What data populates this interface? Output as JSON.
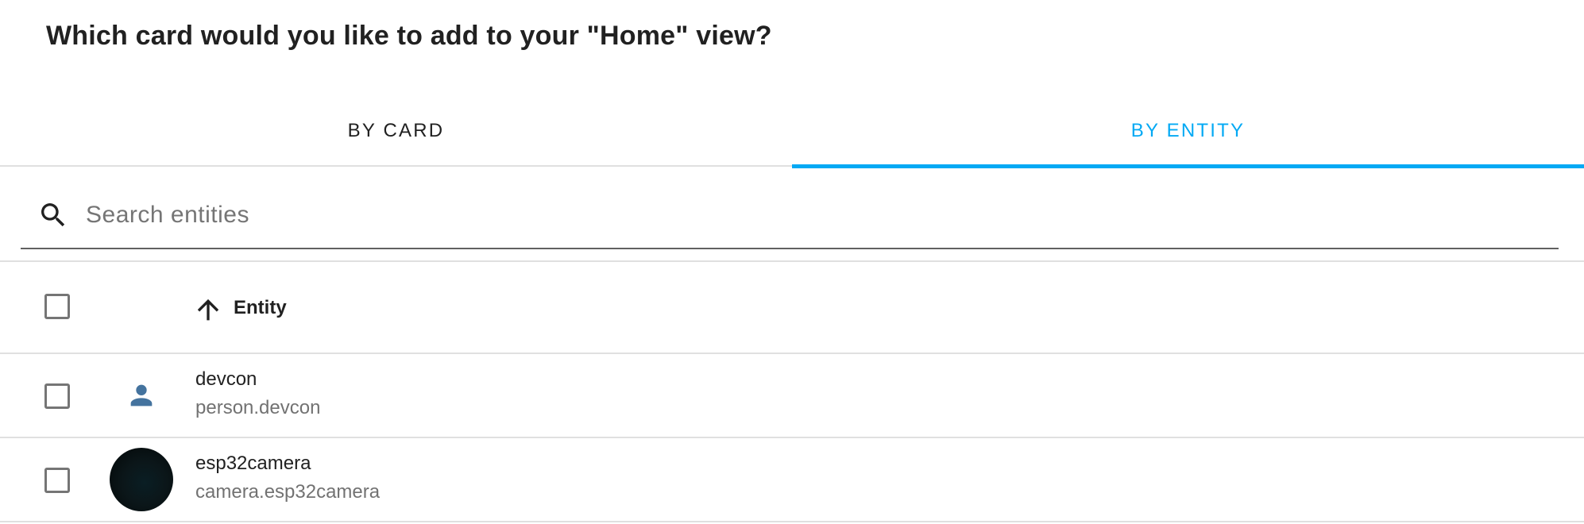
{
  "dialog": {
    "title": "Which card would you like to add to your \"Home\" view?"
  },
  "tabs": [
    {
      "label": "BY CARD",
      "active": false
    },
    {
      "label": "BY ENTITY",
      "active": true
    }
  ],
  "search": {
    "placeholder": "Search entities",
    "value": "",
    "icon": "search-icon"
  },
  "table": {
    "columns": [
      {
        "label": "Entity",
        "sort": "ascending",
        "sort_icon": "arrow-up-icon"
      }
    ],
    "rows": [
      {
        "name": "devcon",
        "entity_id": "person.devcon",
        "icon": "account-icon",
        "icon_color": "#44739e",
        "selected": false
      },
      {
        "name": "esp32camera",
        "entity_id": "camera.esp32camera",
        "icon": "camera-snapshot-thumbnail",
        "selected": false
      }
    ]
  },
  "colors": {
    "accent": "#03a9f4",
    "text_primary": "#212121",
    "text_secondary": "#727272",
    "person_icon": "#44739e",
    "divider": "#e0e0e0"
  }
}
